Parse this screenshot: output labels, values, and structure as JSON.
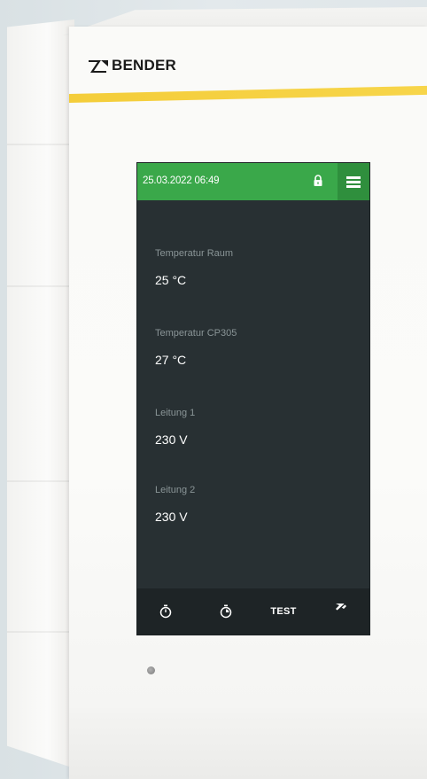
{
  "device": {
    "brand": "BENDER",
    "brand_icon": "bender-logo-icon"
  },
  "screen": {
    "header": {
      "datetime": "25.03.2022 06:49",
      "lock_icon": "lock-icon",
      "menu_icon": "hamburger-menu-icon",
      "color": "#3aa84a",
      "menu_color": "#2f8f3d"
    },
    "readings": [
      {
        "label": "Temperatur Raum",
        "value": "25 °C"
      },
      {
        "label": "Temperatur CP305",
        "value": "27 °C"
      },
      {
        "label": "Leitung 1",
        "value": "230 V"
      },
      {
        "label": "Leitung 2",
        "value": "230 V"
      }
    ],
    "bottom_bar": {
      "timer_icon": "stopwatch-icon",
      "timer_reset_icon": "stopwatch-reset-icon",
      "test_label": "TEST",
      "mute_icon": "mute-horn-icon"
    },
    "background_color": "#283033"
  }
}
